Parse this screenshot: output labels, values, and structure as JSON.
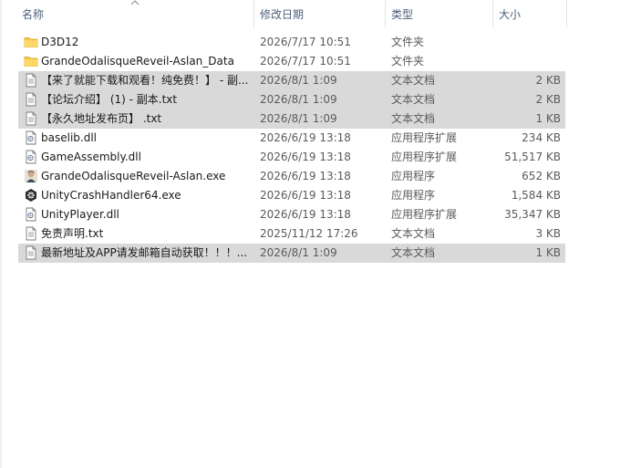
{
  "columns": {
    "name": "名称",
    "date": "修改日期",
    "type": "类型",
    "size": "大小"
  },
  "files": [
    {
      "name": "D3D12",
      "date": "2026/7/17 10:51",
      "type": "文件夹",
      "size": "",
      "icon": "folder-icon",
      "selected": false
    },
    {
      "name": "GrandeOdalisqueReveil-Aslan_Data",
      "date": "2026/7/17 10:51",
      "type": "文件夹",
      "size": "",
      "icon": "folder-icon",
      "selected": false
    },
    {
      "name": "【来了就能下载和观看！纯免费！】 - 副...",
      "date": "2026/8/1 1:09",
      "type": "文本文档",
      "size": "2 KB",
      "icon": "text-file-icon",
      "selected": true
    },
    {
      "name": "【论坛介绍】 (1) - 副本.txt",
      "date": "2026/8/1 1:09",
      "type": "文本文档",
      "size": "2 KB",
      "icon": "text-file-icon",
      "selected": true
    },
    {
      "name": "【永久地址发布页】 .txt",
      "date": "2026/8/1 1:09",
      "type": "文本文档",
      "size": "1 KB",
      "icon": "text-file-icon",
      "selected": true
    },
    {
      "name": "baselib.dll",
      "date": "2026/6/19 13:18",
      "type": "应用程序扩展",
      "size": "234 KB",
      "icon": "dll-file-icon",
      "selected": false
    },
    {
      "name": "GameAssembly.dll",
      "date": "2026/6/19 13:18",
      "type": "应用程序扩展",
      "size": "51,517 KB",
      "icon": "dll-file-icon",
      "selected": false
    },
    {
      "name": "GrandeOdalisqueReveil-Aslan.exe",
      "date": "2026/6/19 13:18",
      "type": "应用程序",
      "size": "652 KB",
      "icon": "game-exe-icon",
      "selected": false
    },
    {
      "name": "UnityCrashHandler64.exe",
      "date": "2026/6/19 13:18",
      "type": "应用程序",
      "size": "1,584 KB",
      "icon": "unity-exe-icon",
      "selected": false
    },
    {
      "name": "UnityPlayer.dll",
      "date": "2026/6/19 13:18",
      "type": "应用程序扩展",
      "size": "35,347 KB",
      "icon": "dll-file-icon",
      "selected": false
    },
    {
      "name": "免责声明.txt",
      "date": "2025/11/12 17:26",
      "type": "文本文档",
      "size": "3 KB",
      "icon": "text-file-icon",
      "selected": false
    },
    {
      "name": "最新地址及APP请发邮箱自动获取！！！...",
      "date": "2026/8/1 1:09",
      "type": "文本文档",
      "size": "1 KB",
      "icon": "text-file-icon",
      "selected": true
    }
  ],
  "colors": {
    "selection": "#d9d9d9",
    "folder": "#f5c542",
    "header_text": "#4c607a"
  }
}
